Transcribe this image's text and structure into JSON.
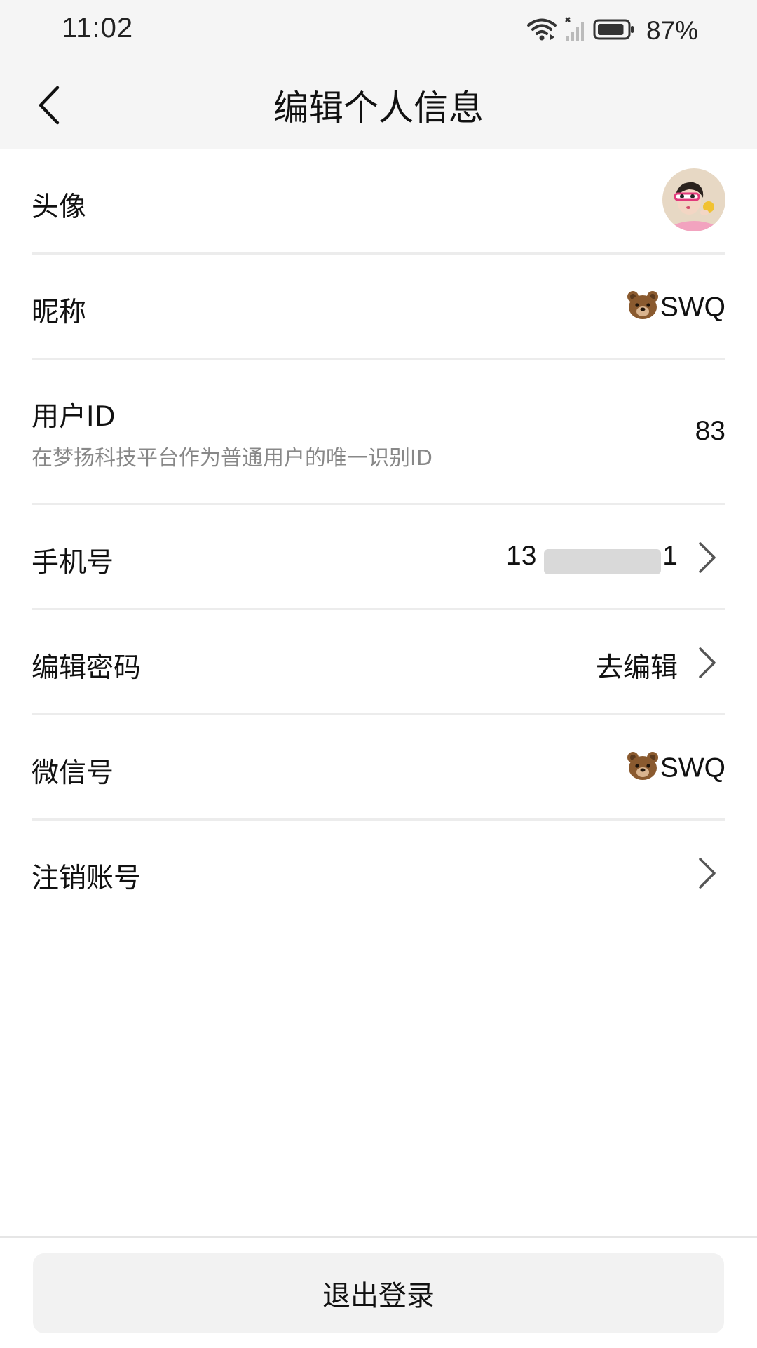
{
  "status_bar": {
    "time": "11:02",
    "battery_percent": "87%",
    "battery_level": 0.87
  },
  "header": {
    "title": "编辑个人信息"
  },
  "rows": {
    "avatar": {
      "label": "头像"
    },
    "nickname": {
      "label": "昵称",
      "emoji": "🐻",
      "value": "SWQ"
    },
    "user_id": {
      "label": "用户ID",
      "description": "在梦扬科技平台作为普通用户的唯一识别ID",
      "value": "83"
    },
    "phone": {
      "label": "手机号",
      "value_prefix": "13",
      "value_suffix": "1"
    },
    "password": {
      "label": "编辑密码",
      "value": "去编辑"
    },
    "wechat": {
      "label": "微信号",
      "emoji": "🐻",
      "value": "SWQ"
    },
    "cancel_account": {
      "label": "注销账号"
    }
  },
  "footer": {
    "logout_label": "退出登录"
  }
}
